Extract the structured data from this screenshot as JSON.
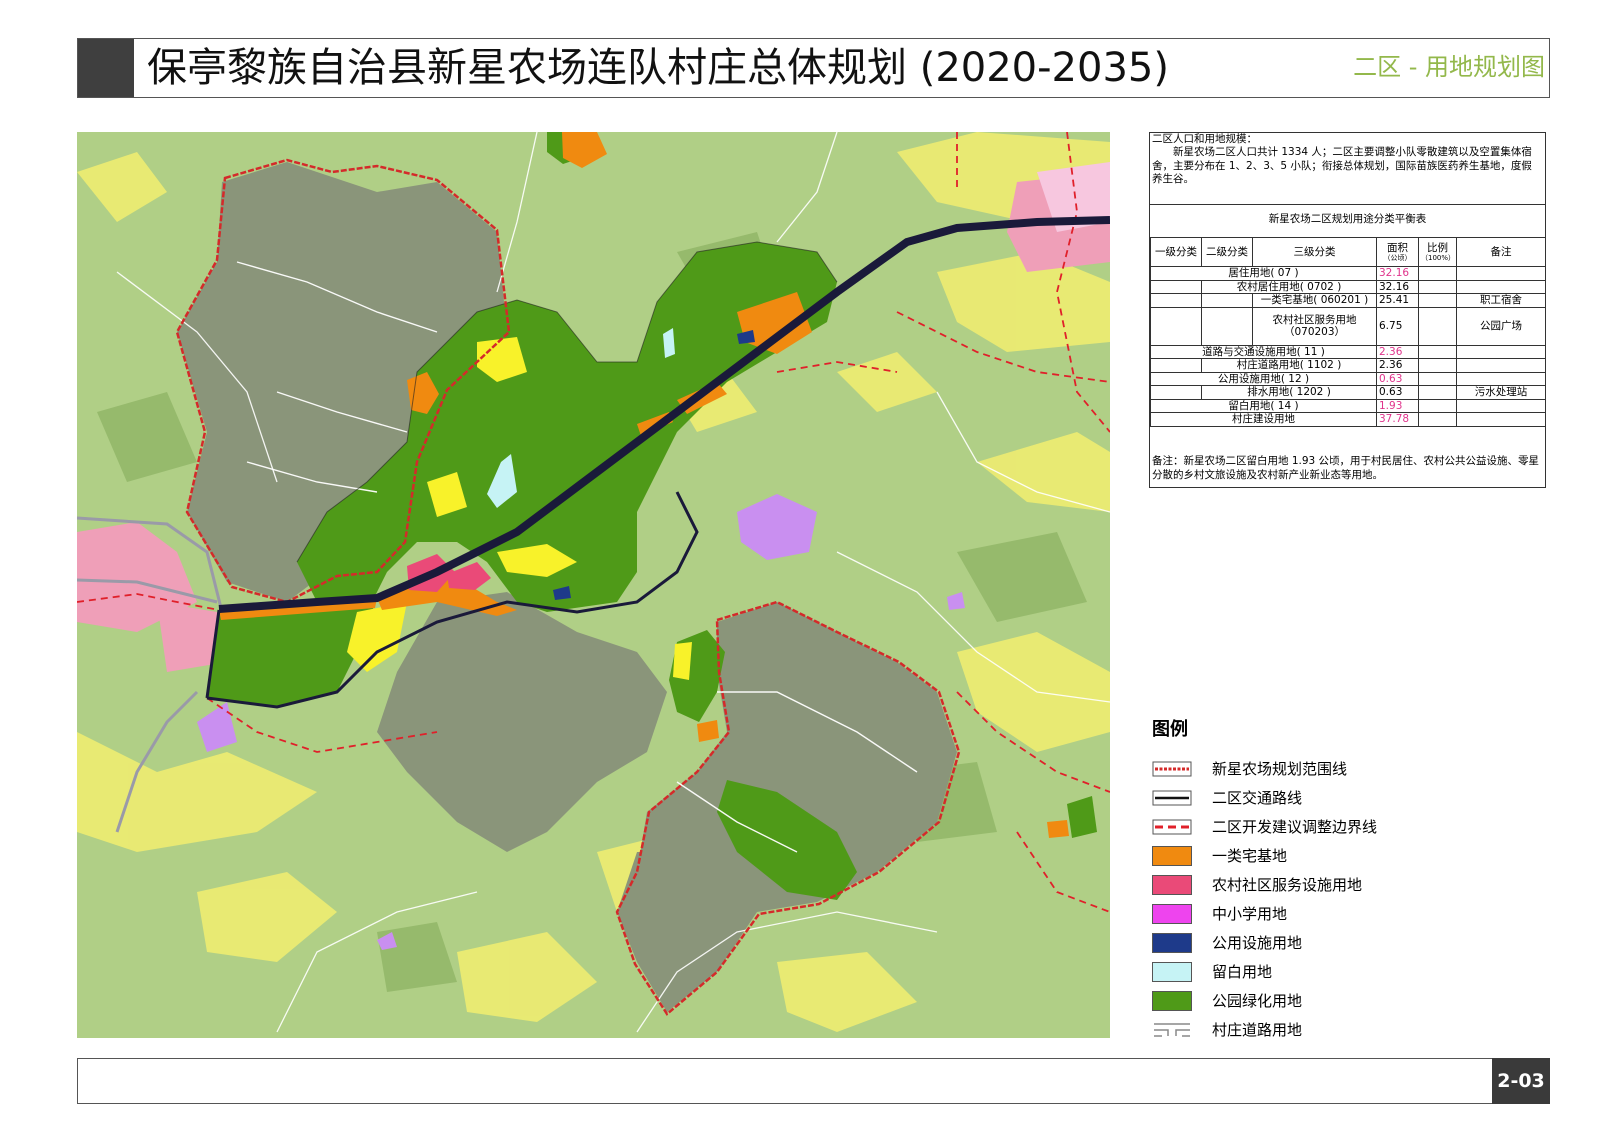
{
  "header": {
    "title": "保亭黎族自治县新星农场连队村庄总体规划 (2020-2035)",
    "subtitle": "二区 - 用地规划图"
  },
  "panel": {
    "intro_heading": "二区人口和用地规模：",
    "intro_text": "新星农场二区人口共计 1334 人；二区主要调整小队零散建筑以及空置集体宿舍，主要分布在 1、2、3、5 小队；衔接总体规划，国际苗族医药养生基地，度假养生谷。",
    "table_title": "新星农场二区规划用途分类平衡表",
    "columns": {
      "level1": "一级分类",
      "level2": "二级分类",
      "level3": "三级分类",
      "area": "面积",
      "area_unit": "（公顷）",
      "ratio": "比例",
      "ratio_unit": "（100%）",
      "note": "备注"
    },
    "rows": [
      {
        "label": "居住用地( 07 )",
        "area": "32.16",
        "ratio": "",
        "note": ""
      },
      {
        "label": "农村居住用地( 0702 )",
        "area": "32.16",
        "ratio": "",
        "note": ""
      },
      {
        "label": "一类宅基地( 060201 )",
        "area": "25.41",
        "ratio": "",
        "note": "职工宿舍"
      },
      {
        "label": "农村社区服务用地（070203）",
        "area": "6.75",
        "ratio": "",
        "note": "公园广场"
      },
      {
        "label": "道路与交通设施用地( 11 )",
        "area": "2.36",
        "ratio": "",
        "note": ""
      },
      {
        "label": "村庄道路用地( 1102 )",
        "area": "2.36",
        "ratio": "",
        "note": ""
      },
      {
        "label": "公用设施用地( 12 )",
        "area": "0.63",
        "ratio": "",
        "note": ""
      },
      {
        "label": "排水用地( 1202 )",
        "area": "0.63",
        "ratio": "",
        "note": "污水处理站"
      },
      {
        "label": "留白用地( 14 )",
        "area": "1.93",
        "ratio": "",
        "note": ""
      },
      {
        "label": "村庄建设用地",
        "area": "37.78",
        "ratio": "",
        "note": ""
      }
    ],
    "note": "备注：新星农场二区留白用地 1.93 公顷，用于村民居住、农村公共公益设施、零星分散的乡村文旅设施及农村新产业新业态等用地。"
  },
  "legend": {
    "heading": "图例",
    "items": [
      {
        "icon": "red-dotted-boundary",
        "label": "新星农场规划范围线",
        "color": "#d42a2a"
      },
      {
        "icon": "black-road-line",
        "label": "二区交通路线",
        "color": "#111111"
      },
      {
        "icon": "red-dashed-boundary",
        "label": "二区开发建议调整边界线",
        "color": "#e0202a"
      },
      {
        "icon": "orange-swatch",
        "label": "一类宅基地",
        "color": "#f08a10"
      },
      {
        "icon": "pink-swatch",
        "label": "农村社区服务设施用地",
        "color": "#ea4a78"
      },
      {
        "icon": "magenta-swatch",
        "label": "中小学用地",
        "color": "#ee44ee"
      },
      {
        "icon": "navy-swatch",
        "label": "公用设施用地",
        "color": "#1e3a8a"
      },
      {
        "icon": "lightblue-swatch",
        "label": "留白用地",
        "color": "#c6f3f5"
      },
      {
        "icon": "green-swatch",
        "label": "公园绿化用地",
        "color": "#4f9a18"
      },
      {
        "icon": "road-outline-icon",
        "label": "村庄道路用地",
        "color": "#999999"
      }
    ]
  },
  "footer": {
    "page_number": "2-03"
  }
}
